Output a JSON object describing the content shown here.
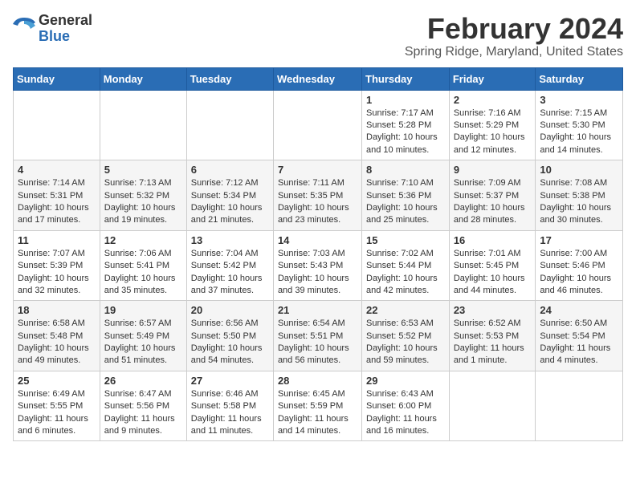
{
  "logo": {
    "general": "General",
    "blue": "Blue"
  },
  "header": {
    "month": "February 2024",
    "location": "Spring Ridge, Maryland, United States"
  },
  "weekdays": [
    "Sunday",
    "Monday",
    "Tuesday",
    "Wednesday",
    "Thursday",
    "Friday",
    "Saturday"
  ],
  "weeks": [
    [
      {
        "day": "",
        "sunrise": "",
        "sunset": "",
        "daylight": ""
      },
      {
        "day": "",
        "sunrise": "",
        "sunset": "",
        "daylight": ""
      },
      {
        "day": "",
        "sunrise": "",
        "sunset": "",
        "daylight": ""
      },
      {
        "day": "",
        "sunrise": "",
        "sunset": "",
        "daylight": ""
      },
      {
        "day": "1",
        "sunrise": "Sunrise: 7:17 AM",
        "sunset": "Sunset: 5:28 PM",
        "daylight": "Daylight: 10 hours and 10 minutes."
      },
      {
        "day": "2",
        "sunrise": "Sunrise: 7:16 AM",
        "sunset": "Sunset: 5:29 PM",
        "daylight": "Daylight: 10 hours and 12 minutes."
      },
      {
        "day": "3",
        "sunrise": "Sunrise: 7:15 AM",
        "sunset": "Sunset: 5:30 PM",
        "daylight": "Daylight: 10 hours and 14 minutes."
      }
    ],
    [
      {
        "day": "4",
        "sunrise": "Sunrise: 7:14 AM",
        "sunset": "Sunset: 5:31 PM",
        "daylight": "Daylight: 10 hours and 17 minutes."
      },
      {
        "day": "5",
        "sunrise": "Sunrise: 7:13 AM",
        "sunset": "Sunset: 5:32 PM",
        "daylight": "Daylight: 10 hours and 19 minutes."
      },
      {
        "day": "6",
        "sunrise": "Sunrise: 7:12 AM",
        "sunset": "Sunset: 5:34 PM",
        "daylight": "Daylight: 10 hours and 21 minutes."
      },
      {
        "day": "7",
        "sunrise": "Sunrise: 7:11 AM",
        "sunset": "Sunset: 5:35 PM",
        "daylight": "Daylight: 10 hours and 23 minutes."
      },
      {
        "day": "8",
        "sunrise": "Sunrise: 7:10 AM",
        "sunset": "Sunset: 5:36 PM",
        "daylight": "Daylight: 10 hours and 25 minutes."
      },
      {
        "day": "9",
        "sunrise": "Sunrise: 7:09 AM",
        "sunset": "Sunset: 5:37 PM",
        "daylight": "Daylight: 10 hours and 28 minutes."
      },
      {
        "day": "10",
        "sunrise": "Sunrise: 7:08 AM",
        "sunset": "Sunset: 5:38 PM",
        "daylight": "Daylight: 10 hours and 30 minutes."
      }
    ],
    [
      {
        "day": "11",
        "sunrise": "Sunrise: 7:07 AM",
        "sunset": "Sunset: 5:39 PM",
        "daylight": "Daylight: 10 hours and 32 minutes."
      },
      {
        "day": "12",
        "sunrise": "Sunrise: 7:06 AM",
        "sunset": "Sunset: 5:41 PM",
        "daylight": "Daylight: 10 hours and 35 minutes."
      },
      {
        "day": "13",
        "sunrise": "Sunrise: 7:04 AM",
        "sunset": "Sunset: 5:42 PM",
        "daylight": "Daylight: 10 hours and 37 minutes."
      },
      {
        "day": "14",
        "sunrise": "Sunrise: 7:03 AM",
        "sunset": "Sunset: 5:43 PM",
        "daylight": "Daylight: 10 hours and 39 minutes."
      },
      {
        "day": "15",
        "sunrise": "Sunrise: 7:02 AM",
        "sunset": "Sunset: 5:44 PM",
        "daylight": "Daylight: 10 hours and 42 minutes."
      },
      {
        "day": "16",
        "sunrise": "Sunrise: 7:01 AM",
        "sunset": "Sunset: 5:45 PM",
        "daylight": "Daylight: 10 hours and 44 minutes."
      },
      {
        "day": "17",
        "sunrise": "Sunrise: 7:00 AM",
        "sunset": "Sunset: 5:46 PM",
        "daylight": "Daylight: 10 hours and 46 minutes."
      }
    ],
    [
      {
        "day": "18",
        "sunrise": "Sunrise: 6:58 AM",
        "sunset": "Sunset: 5:48 PM",
        "daylight": "Daylight: 10 hours and 49 minutes."
      },
      {
        "day": "19",
        "sunrise": "Sunrise: 6:57 AM",
        "sunset": "Sunset: 5:49 PM",
        "daylight": "Daylight: 10 hours and 51 minutes."
      },
      {
        "day": "20",
        "sunrise": "Sunrise: 6:56 AM",
        "sunset": "Sunset: 5:50 PM",
        "daylight": "Daylight: 10 hours and 54 minutes."
      },
      {
        "day": "21",
        "sunrise": "Sunrise: 6:54 AM",
        "sunset": "Sunset: 5:51 PM",
        "daylight": "Daylight: 10 hours and 56 minutes."
      },
      {
        "day": "22",
        "sunrise": "Sunrise: 6:53 AM",
        "sunset": "Sunset: 5:52 PM",
        "daylight": "Daylight: 10 hours and 59 minutes."
      },
      {
        "day": "23",
        "sunrise": "Sunrise: 6:52 AM",
        "sunset": "Sunset: 5:53 PM",
        "daylight": "Daylight: 11 hours and 1 minute."
      },
      {
        "day": "24",
        "sunrise": "Sunrise: 6:50 AM",
        "sunset": "Sunset: 5:54 PM",
        "daylight": "Daylight: 11 hours and 4 minutes."
      }
    ],
    [
      {
        "day": "25",
        "sunrise": "Sunrise: 6:49 AM",
        "sunset": "Sunset: 5:55 PM",
        "daylight": "Daylight: 11 hours and 6 minutes."
      },
      {
        "day": "26",
        "sunrise": "Sunrise: 6:47 AM",
        "sunset": "Sunset: 5:56 PM",
        "daylight": "Daylight: 11 hours and 9 minutes."
      },
      {
        "day": "27",
        "sunrise": "Sunrise: 6:46 AM",
        "sunset": "Sunset: 5:58 PM",
        "daylight": "Daylight: 11 hours and 11 minutes."
      },
      {
        "day": "28",
        "sunrise": "Sunrise: 6:45 AM",
        "sunset": "Sunset: 5:59 PM",
        "daylight": "Daylight: 11 hours and 14 minutes."
      },
      {
        "day": "29",
        "sunrise": "Sunrise: 6:43 AM",
        "sunset": "Sunset: 6:00 PM",
        "daylight": "Daylight: 11 hours and 16 minutes."
      },
      {
        "day": "",
        "sunrise": "",
        "sunset": "",
        "daylight": ""
      },
      {
        "day": "",
        "sunrise": "",
        "sunset": "",
        "daylight": ""
      }
    ]
  ]
}
